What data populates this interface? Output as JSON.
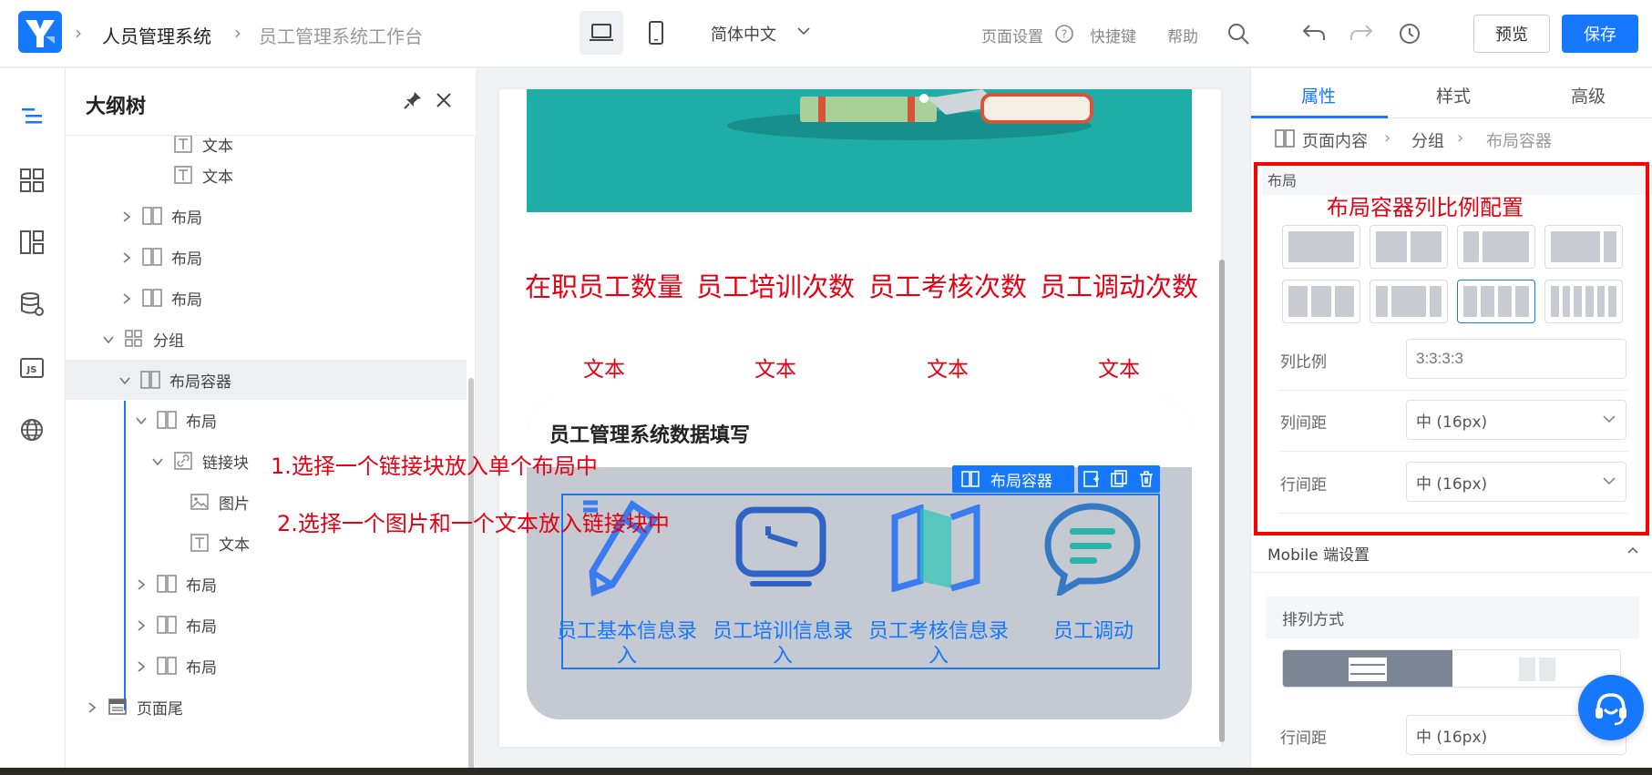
{
  "header": {
    "breadcrumb_root": "人员管理系统",
    "breadcrumb_current": "员工管理系统工作台",
    "language": "简体中文",
    "page_settings": "页面设置",
    "shortcuts": "快捷键",
    "help": "帮助",
    "preview": "预览",
    "save": "保存"
  },
  "outline": {
    "title": "大纲树",
    "rows": [
      {
        "label": "文本",
        "icon": "text-icon"
      },
      {
        "label": "文本",
        "icon": "text-icon"
      },
      {
        "label": "布局",
        "icon": "layout-icon"
      },
      {
        "label": "布局",
        "icon": "layout-icon"
      },
      {
        "label": "布局",
        "icon": "layout-icon"
      },
      {
        "label": "分组",
        "icon": "group-icon"
      },
      {
        "label": "布局容器",
        "icon": "layout-icon"
      },
      {
        "label": "布局",
        "icon": "layout-icon"
      },
      {
        "label": "链接块",
        "icon": "link-icon"
      },
      {
        "label": "图片",
        "icon": "image-icon"
      },
      {
        "label": "文本",
        "icon": "text-icon"
      },
      {
        "label": "布局",
        "icon": "layout-icon"
      },
      {
        "label": "布局",
        "icon": "layout-icon"
      },
      {
        "label": "布局",
        "icon": "layout-icon"
      },
      {
        "label": "页面尾",
        "icon": "footer-icon"
      }
    ]
  },
  "canvas": {
    "stats": [
      {
        "title": "在职员工数量",
        "sub": "文本"
      },
      {
        "title": "员工培训次数",
        "sub": "文本"
      },
      {
        "title": "员工考核次数",
        "sub": "文本"
      },
      {
        "title": "员工调动次数",
        "sub": "文本"
      }
    ],
    "form_title": "员工管理系统数据填写",
    "selection_tag": "布局容器",
    "links": [
      {
        "label": "员工基本信息录入",
        "icon": "pencil-icon"
      },
      {
        "label": "员工培训信息录入",
        "icon": "monitor-icon"
      },
      {
        "label": "员工考核信息录入",
        "icon": "map-icon"
      },
      {
        "label": "员工调动",
        "icon": "chat-icon"
      }
    ]
  },
  "annotations": {
    "step1": "1.选择一个链接块放入单个布局中",
    "step2": "2.选择一个图片和一个文本放入链接块中",
    "layout_note": "布局容器列比例配置"
  },
  "right_panel": {
    "tabs": [
      "属性",
      "样式",
      "高级"
    ],
    "active_tab": "属性",
    "breadcrumb": [
      "页面内容",
      "分组",
      "布局容器"
    ],
    "layout_section": "布局",
    "column_ratio_label": "列比例",
    "column_ratio_placeholder": "3:3:3:3",
    "column_gap_label": "列间距",
    "column_gap_value": "中 (16px)",
    "row_gap_label": "行间距",
    "row_gap_value": "中 (16px)",
    "mobile_section": "Mobile 端设置",
    "arrangement_label": "排列方式",
    "mobile_row_gap_label": "行间距",
    "mobile_row_gap_value": "中 (16px)"
  },
  "colors": {
    "primary": "#1677ff",
    "annotation_red": "#e60012",
    "banner_teal": "#1fada7"
  }
}
